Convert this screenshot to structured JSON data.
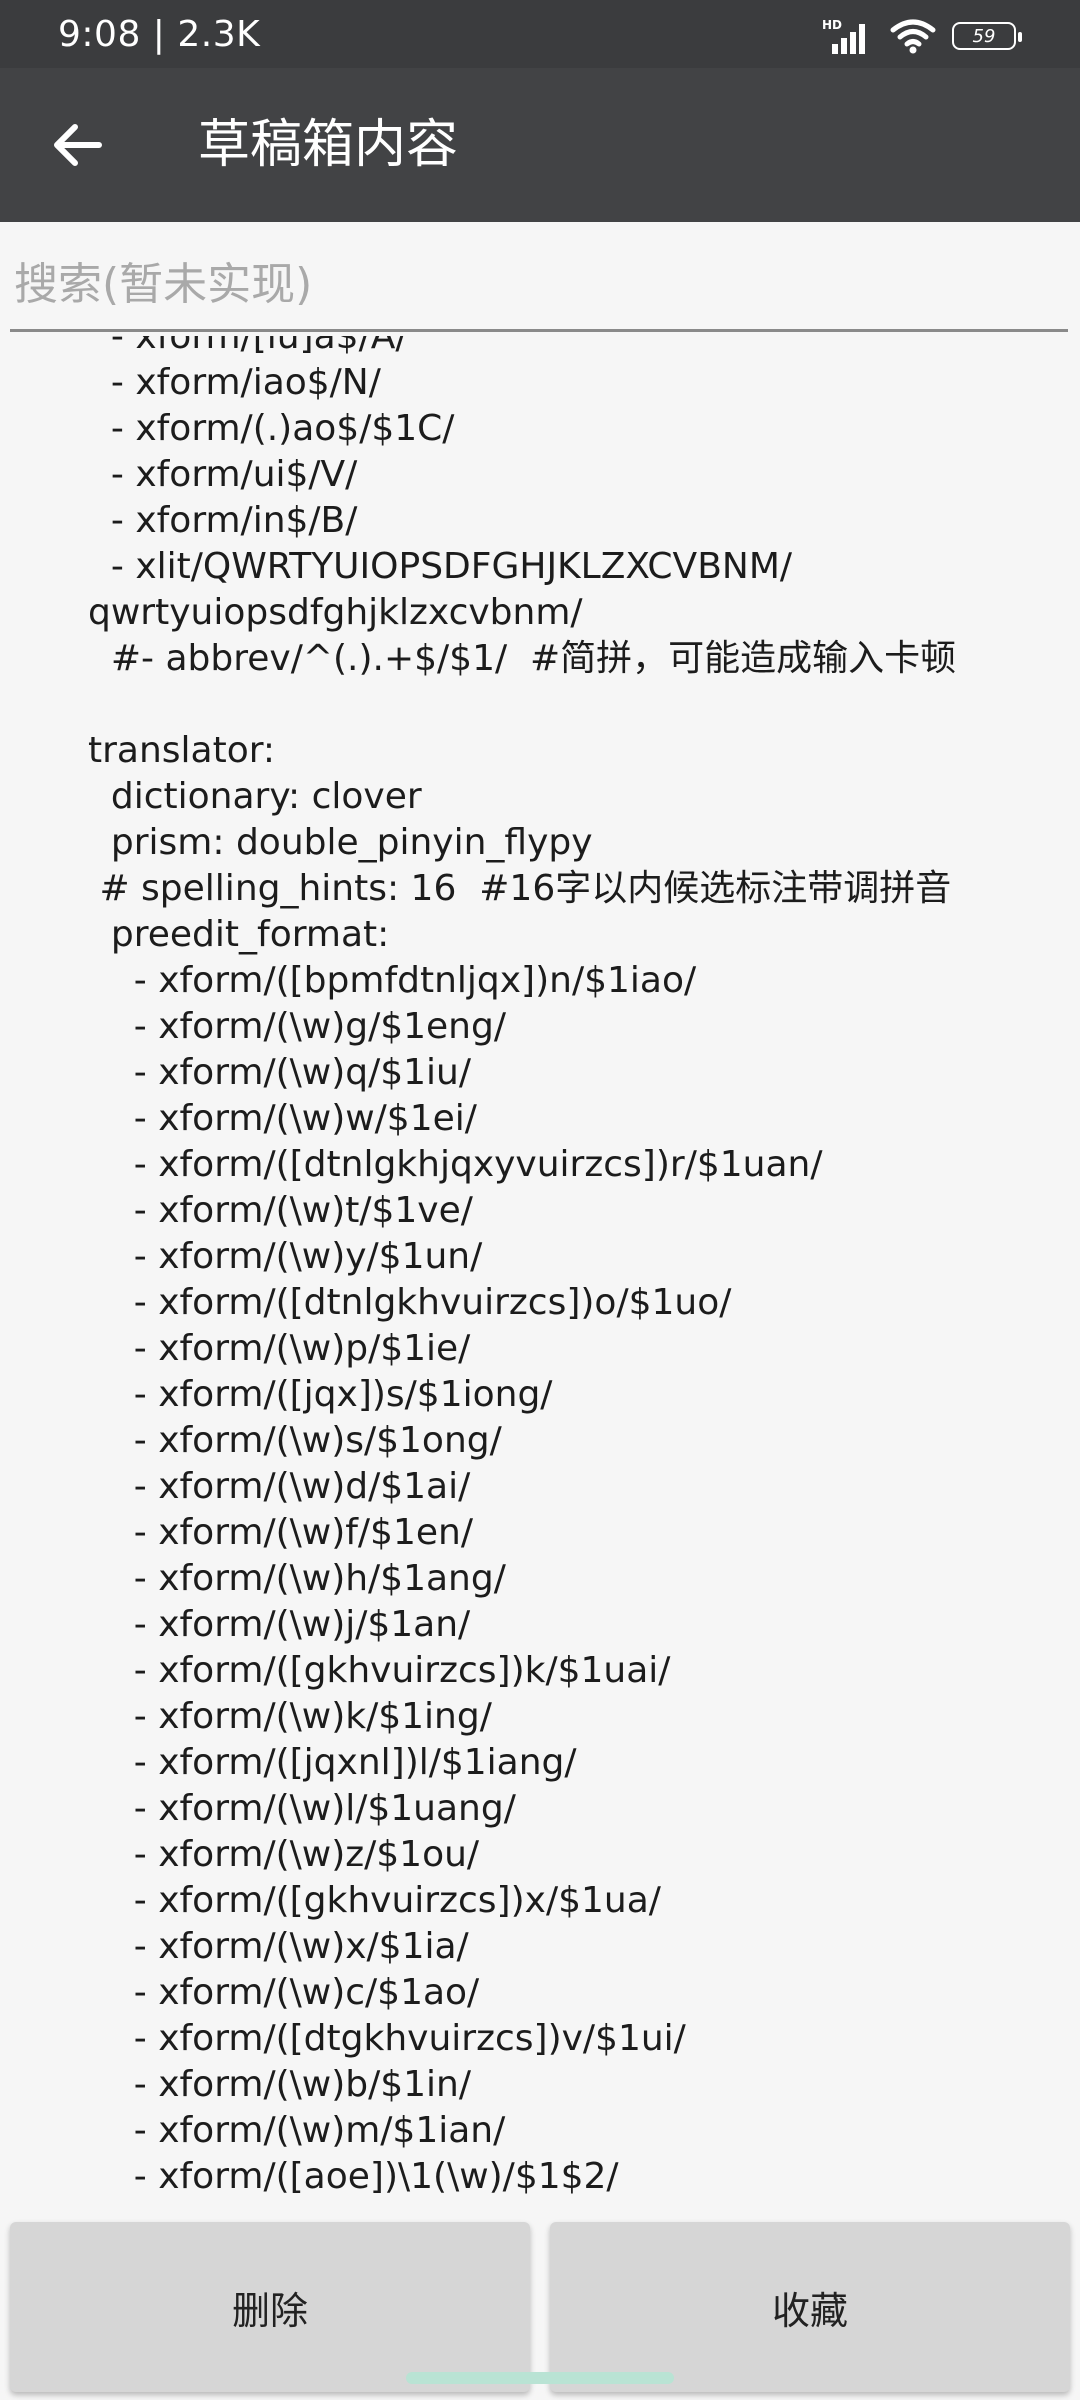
{
  "status_bar": {
    "time_traffic": "9:08 | 2.3K",
    "network_label": "HD",
    "battery_level": "59"
  },
  "header": {
    "title": "草稿箱内容"
  },
  "search": {
    "placeholder": "搜索(暂未实现)",
    "value": ""
  },
  "content": {
    "text": "  - xform/[iu]a$/A/\n  - xform/iao$/N/\n  - xform/(.)ao$/$1C/\n  - xform/ui$/V/\n  - xform/in$/B/\n  - xlit/QWRTYUIOPSDFGHJKLZXCVBNM/\nqwrtyuiopsdfghjklzxcvbnm/\n  #- abbrev/^(.).+$/$1/  #简拼，可能造成输入卡顿\n\ntranslator:\n  dictionary: clover\n  prism: double_pinyin_flypy\n # spelling_hints: 16  #16字以内候选标注带调拼音\n  preedit_format:\n    - xform/([bpmfdtnljqx])n/$1iao/\n    - xform/(\\w)g/$1eng/\n    - xform/(\\w)q/$1iu/\n    - xform/(\\w)w/$1ei/\n    - xform/([dtnlgkhjqxyvuirzcs])r/$1uan/\n    - xform/(\\w)t/$1ve/\n    - xform/(\\w)y/$1un/\n    - xform/([dtnlgkhvuirzcs])o/$1uo/\n    - xform/(\\w)p/$1ie/\n    - xform/([jqx])s/$1iong/\n    - xform/(\\w)s/$1ong/\n    - xform/(\\w)d/$1ai/\n    - xform/(\\w)f/$1en/\n    - xform/(\\w)h/$1ang/\n    - xform/(\\w)j/$1an/\n    - xform/([gkhvuirzcs])k/$1uai/\n    - xform/(\\w)k/$1ing/\n    - xform/([jqxnl])l/$1iang/\n    - xform/(\\w)l/$1uang/\n    - xform/(\\w)z/$1ou/\n    - xform/([gkhvuirzcs])x/$1ua/\n    - xform/(\\w)x/$1ia/\n    - xform/(\\w)c/$1ao/\n    - xform/([dtgkhvuirzcs])v/$1ui/\n    - xform/(\\w)b/$1in/\n    - xform/(\\w)m/$1ian/\n    - xform/([aoe])\\1(\\w)/$1$2/"
  },
  "actions": {
    "delete_label": "删除",
    "favorite_label": "收藏"
  }
}
